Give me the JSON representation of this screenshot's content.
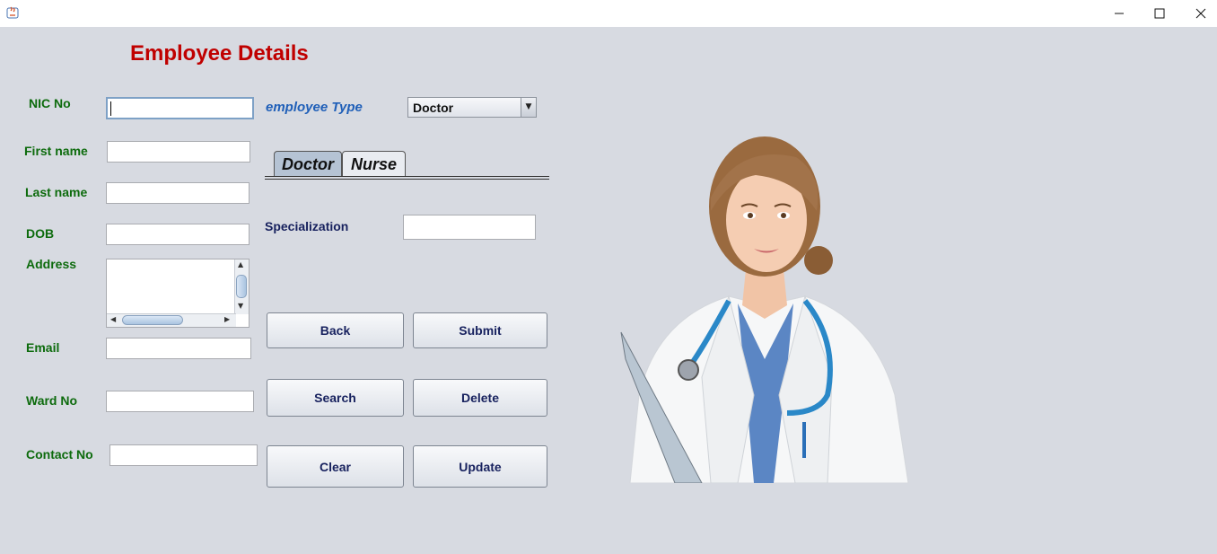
{
  "window": {
    "app_icon": "java-icon",
    "minimize_icon": "minimize-icon",
    "maximize_icon": "maximize-icon",
    "close_icon": "close-icon"
  },
  "form": {
    "title": "Employee Details",
    "labels": {
      "nic": "NIC No",
      "first_name": "First name",
      "last_name": "Last name",
      "dob": "DOB",
      "address": "Address",
      "email": "Email",
      "ward": "Ward No",
      "contact": "Contact No"
    },
    "values": {
      "nic": "",
      "first_name": "",
      "last_name": "",
      "dob": "",
      "address": "",
      "email": "",
      "ward": "",
      "contact": ""
    }
  },
  "employee_type": {
    "label": "employee Type",
    "selected": "Doctor"
  },
  "tabs": [
    {
      "label": "Doctor",
      "active": true
    },
    {
      "label": "Nurse",
      "active": false
    }
  ],
  "doctor_panel": {
    "specialization_label": "Specialization",
    "specialization_value": ""
  },
  "buttons": {
    "back": "Back",
    "submit": "Submit",
    "search": "Search",
    "delete": "Delete",
    "clear": "Clear",
    "update": "Update"
  },
  "colors": {
    "title": "#c00000",
    "label_green": "#0d6b0d",
    "button_text": "#17215e",
    "background": "#d7dae1"
  }
}
